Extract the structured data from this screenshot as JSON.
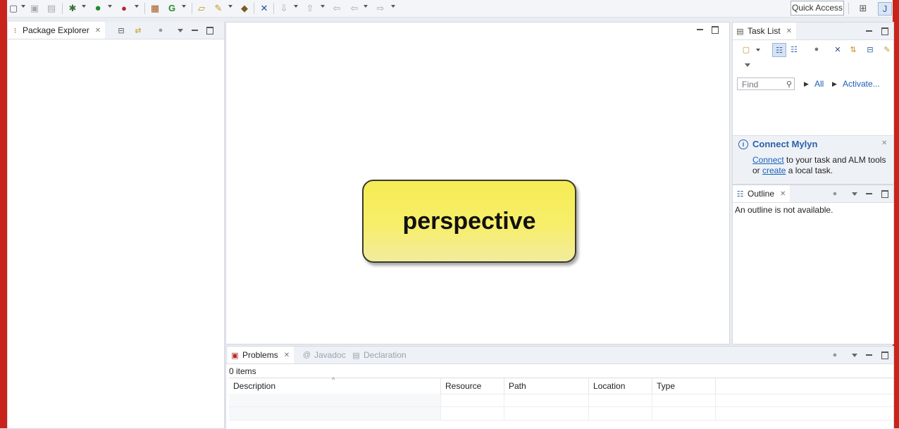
{
  "toolbar": {
    "quick_access": "Quick Access",
    "icons": [
      "new-icon",
      "save-icon",
      "save-all-icon",
      "debug-icon",
      "run-icon",
      "external-tools-icon",
      "new-java-package-icon",
      "new-class-icon",
      "open-type-icon",
      "search-icon",
      "open-task-icon",
      "toggle-annotation-icon",
      "next-annotation-icon",
      "previous-annotation-icon",
      "last-edit-icon",
      "back-icon",
      "forward-icon",
      "open-perspective-icon",
      "java-perspective-icon"
    ]
  },
  "package_explorer": {
    "tab_label": "Package Explorer"
  },
  "editor": {
    "overlay_label": "perspective",
    "overlay_colors": {
      "fill": "#f5ec55",
      "border": "#3a3a2c"
    }
  },
  "task_list": {
    "tab_label": "Task List",
    "find_placeholder": "Find",
    "all_label": "All",
    "activate_label": "Activate...",
    "connect_title": "Connect Mylyn",
    "connect_link": "Connect",
    "connect_text_1": " to your task and ALM tools",
    "connect_text_2": "or ",
    "create_link": "create",
    "connect_text_3": " a local task."
  },
  "outline": {
    "tab_label": "Outline",
    "message": "An outline is not available."
  },
  "problems": {
    "tabs": [
      {
        "label": "Problems",
        "active": true
      },
      {
        "label": "Javadoc",
        "active": false
      },
      {
        "label": "Declaration",
        "active": false
      }
    ],
    "item_count": "0 items",
    "columns": [
      "Description",
      "Resource",
      "Path",
      "Location",
      "Type"
    ]
  },
  "colors": {
    "frame": "#c8241c",
    "link": "#1b5fb8"
  }
}
